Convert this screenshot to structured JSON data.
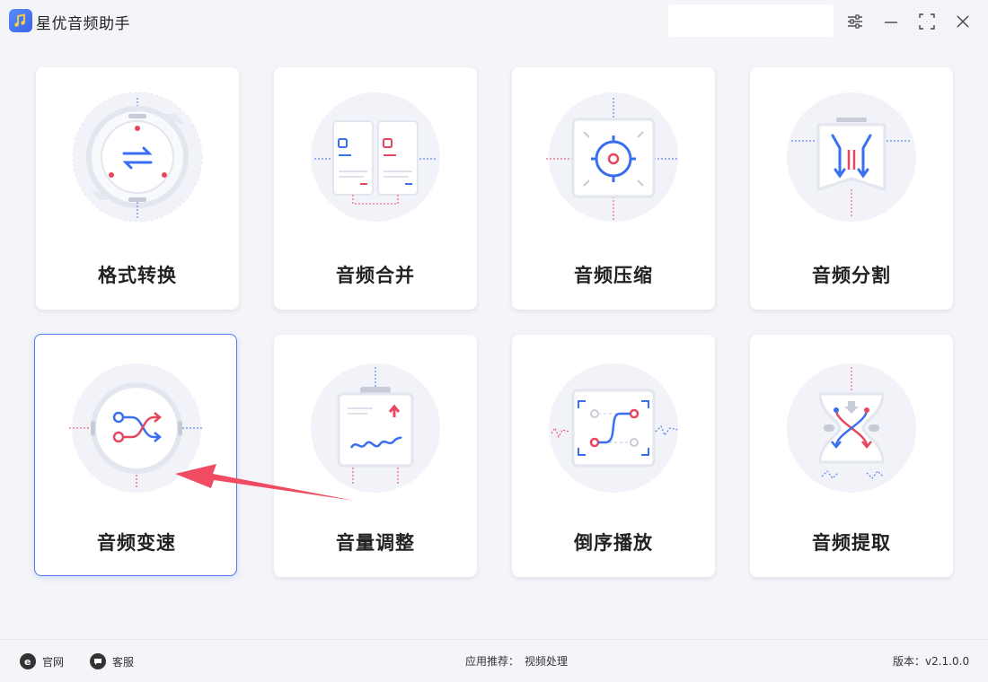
{
  "app": {
    "title": "星优音频助手"
  },
  "window": {
    "search_value": ""
  },
  "cards": [
    {
      "label": "格式转换"
    },
    {
      "label": "音频合并"
    },
    {
      "label": "音频压缩"
    },
    {
      "label": "音频分割"
    },
    {
      "label": "音频变速"
    },
    {
      "label": "音量调整"
    },
    {
      "label": "倒序播放"
    },
    {
      "label": "音频提取"
    }
  ],
  "selected_card": "音频变速",
  "footer": {
    "website_label": "官网",
    "support_label": "客服",
    "recommend_prefix": "应用推荐：",
    "recommend_link": "视频处理",
    "version": "版本：v2.1.0.0"
  },
  "colors": {
    "accent_blue": "#3a6ff0",
    "accent_red": "#e8455f",
    "annotation_arrow": "#ef4b63"
  }
}
